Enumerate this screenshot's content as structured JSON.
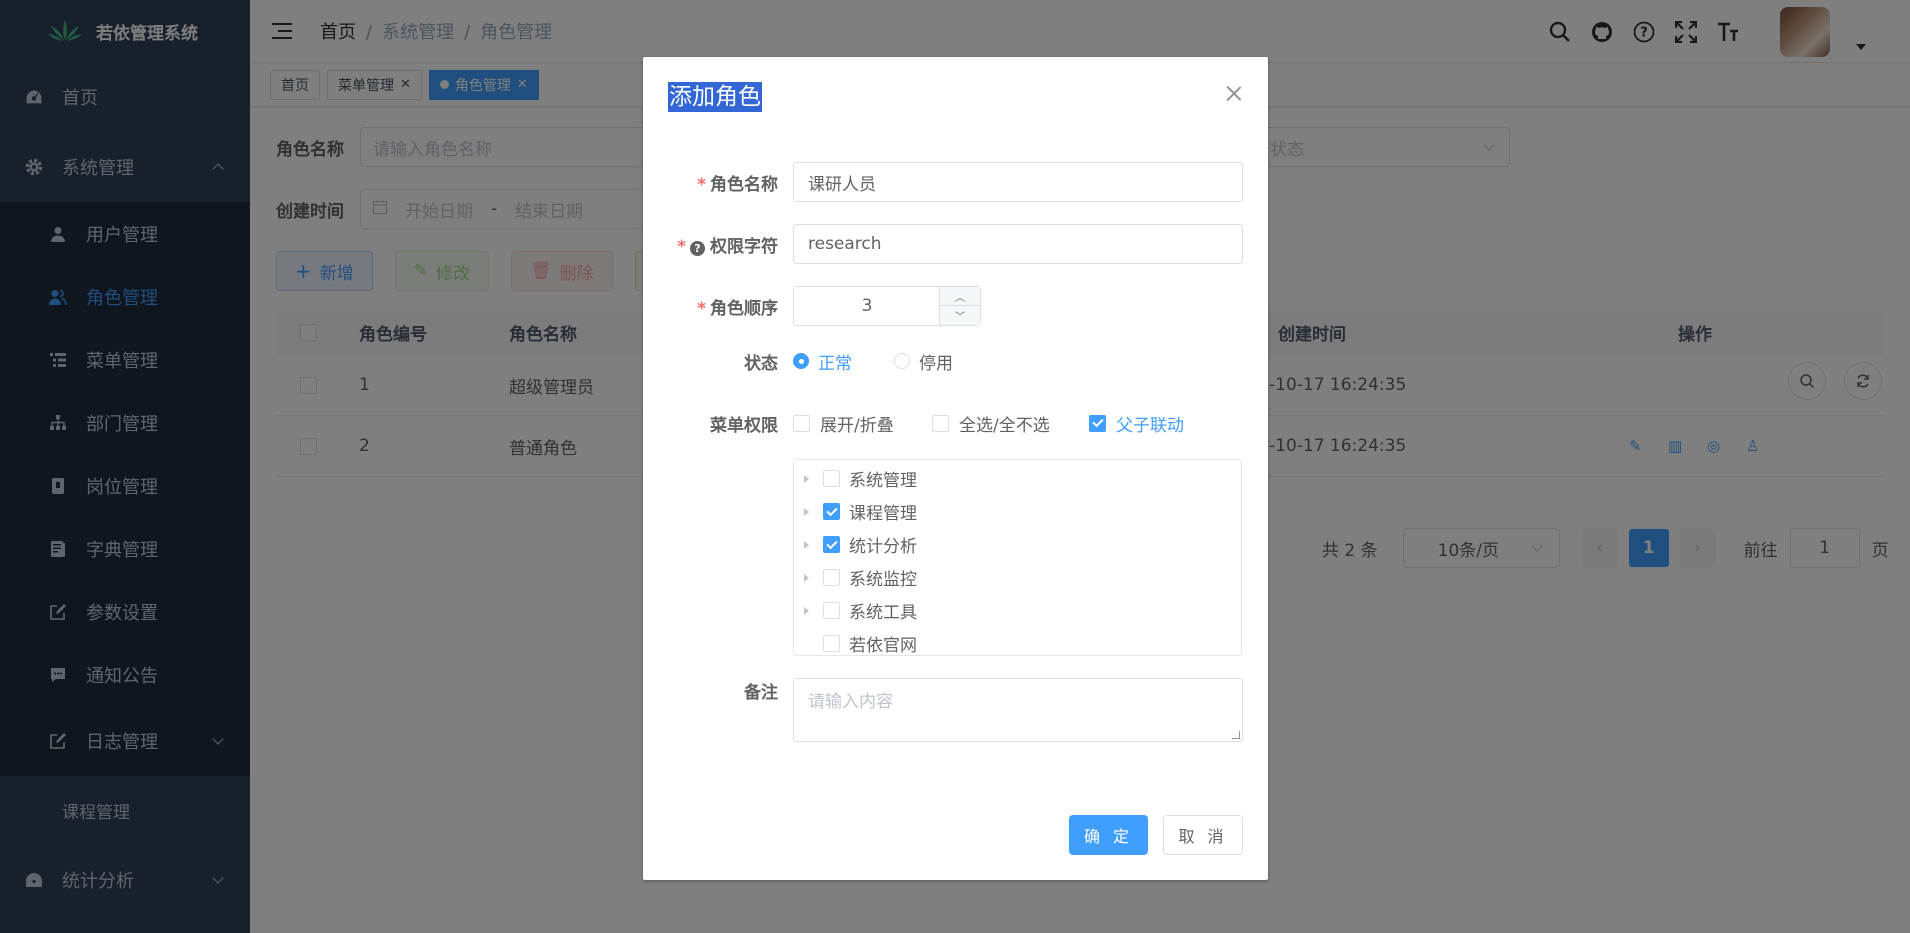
{
  "app": {
    "name": "若依管理系统"
  },
  "sidebar": {
    "items": [
      {
        "label": "首页"
      },
      {
        "label": "系统管理"
      },
      {
        "label": "用户管理"
      },
      {
        "label": "角色管理"
      },
      {
        "label": "菜单管理"
      },
      {
        "label": "部门管理"
      },
      {
        "label": "岗位管理"
      },
      {
        "label": "字典管理"
      },
      {
        "label": "参数设置"
      },
      {
        "label": "通知公告"
      },
      {
        "label": "日志管理"
      },
      {
        "label": "课程管理"
      },
      {
        "label": "统计分析"
      }
    ],
    "active_color": "#409eff",
    "bg_color": "#304156"
  },
  "navbar": {
    "breadcrumb": [
      "首页",
      "系统管理",
      "角色管理"
    ],
    "icons": [
      "search-icon",
      "github-icon",
      "help-icon",
      "fullscreen-icon",
      "font-size-icon"
    ]
  },
  "tags": [
    {
      "label": "首页"
    },
    {
      "label": "菜单管理"
    },
    {
      "label": "角色管理"
    }
  ],
  "search": {
    "role_name_label": "角色名称",
    "role_name_placeholder": "请输入角色名称",
    "status_placeholder": "状态",
    "created_label": "创建时间",
    "start_placeholder": "开始日期",
    "range_sep": "-",
    "end_placeholder": "结束日期"
  },
  "toolbar": {
    "add_label": "新增",
    "edit_label": "修改",
    "delete_label": "删除"
  },
  "table": {
    "columns": [
      "角色编号",
      "角色名称",
      "创建时间",
      "操作"
    ],
    "rows": [
      {
        "id": "1",
        "name": "超级管理员",
        "created": "-10-17 16:24:35"
      },
      {
        "id": "2",
        "name": "普通角色",
        "created": "-10-17 16:24:35"
      }
    ]
  },
  "pagination": {
    "total": "共 2 条",
    "page_size": "10条/页",
    "current": "1",
    "goto_label": "前往",
    "goto_value": "1",
    "page_suffix": "页"
  },
  "dialog": {
    "title": "添加角色",
    "role_name_label": "角色名称",
    "role_name_value": "课研人员",
    "perm_label": "权限字符",
    "perm_value": "research",
    "order_label": "角色顺序",
    "order_value": "3",
    "status_label": "状态",
    "status_normal": "正常",
    "status_disabled": "停用",
    "menu_perm_label": "菜单权限",
    "opt_expand": "展开/折叠",
    "opt_select_all": "全选/全不选",
    "opt_linkage": "父子联动",
    "tree": [
      {
        "label": "系统管理",
        "checked": false
      },
      {
        "label": "课程管理",
        "checked": true
      },
      {
        "label": "统计分析",
        "checked": true
      },
      {
        "label": "系统监控",
        "checked": false
      },
      {
        "label": "系统工具",
        "checked": false
      },
      {
        "label": "若依官网",
        "checked": false
      }
    ],
    "remark_label": "备注",
    "remark_placeholder": "请输入内容",
    "ok_label": "确 定",
    "cancel_label": "取 消"
  }
}
